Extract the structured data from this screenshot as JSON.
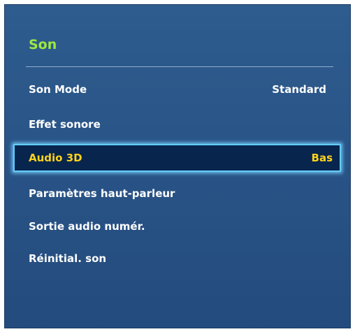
{
  "menu": {
    "title": "Son",
    "colors": {
      "title": "#9ee840",
      "selected_text": "#ffd21c",
      "selected_border": "#62ccff",
      "background": "#2a5588"
    },
    "items": [
      {
        "label": "Son Mode",
        "value": "Standard"
      },
      {
        "label": "Effet sonore",
        "value": ""
      },
      {
        "label": "Audio 3D",
        "value": "Bas",
        "selected": true
      },
      {
        "label": "Paramètres haut-parleur",
        "value": ""
      },
      {
        "label": "Sortie audio numér.",
        "value": ""
      },
      {
        "label": "Réinitial. son",
        "value": ""
      }
    ]
  }
}
